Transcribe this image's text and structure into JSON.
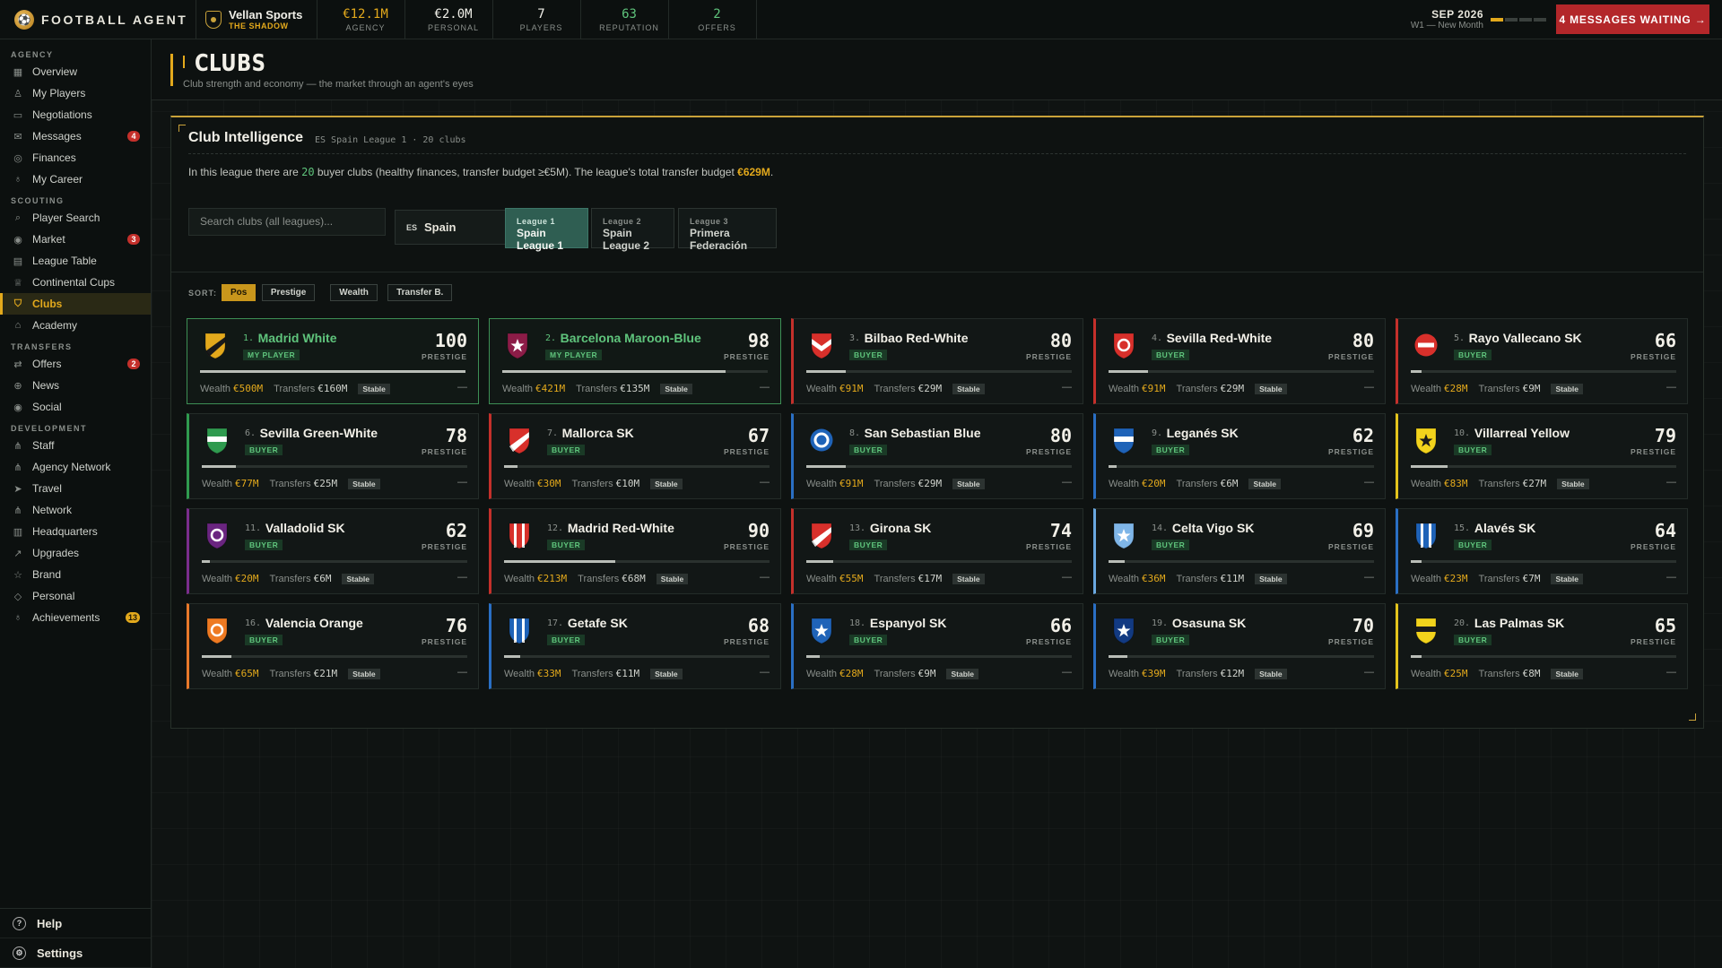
{
  "topbar": {
    "brand": "FOOTBALL AGENT",
    "agency_name": "Vellan Sports",
    "agency_tag": "THE SHADOW",
    "stats": [
      {
        "value": "€12.1M",
        "label": "AGENCY",
        "color": "gold"
      },
      {
        "value": "€2.0M",
        "label": "PERSONAL",
        "color": ""
      },
      {
        "value": "7",
        "label": "PLAYERS",
        "color": ""
      },
      {
        "value": "63",
        "label": "REPUTATION",
        "color": "green"
      },
      {
        "value": "2",
        "label": "OFFERS",
        "color": "green"
      }
    ],
    "date": "SEP 2026",
    "week": "W1 — New Month",
    "week_progress": 0.25,
    "messages_button": "4 MESSAGES WAITING →"
  },
  "sidebar": {
    "sections": [
      {
        "title": "AGENCY",
        "items": [
          {
            "label": "Overview",
            "icon": "grid-icon",
            "glyph": "▦"
          },
          {
            "label": "My Players",
            "icon": "user-icon",
            "glyph": "♙"
          },
          {
            "label": "Negotiations",
            "icon": "chat-icon",
            "glyph": "▭"
          },
          {
            "label": "Messages",
            "icon": "mail-icon",
            "glyph": "✉",
            "badge": "4"
          },
          {
            "label": "Finances",
            "icon": "coin-icon",
            "glyph": "◎"
          },
          {
            "label": "My Career",
            "icon": "medal-icon",
            "glyph": "♁"
          }
        ]
      },
      {
        "title": "SCOUTING",
        "items": [
          {
            "label": "Player Search",
            "icon": "search-icon",
            "glyph": "⌕"
          },
          {
            "label": "Market",
            "icon": "broadcast-icon",
            "glyph": "◉",
            "badge": "3"
          },
          {
            "label": "League Table",
            "icon": "table-icon",
            "glyph": "▤"
          },
          {
            "label": "Continental Cups",
            "icon": "trophy-icon",
            "glyph": "♕"
          },
          {
            "label": "Clubs",
            "icon": "shield-icon",
            "glyph": "⛉",
            "active": true
          },
          {
            "label": "Academy",
            "icon": "graduation-icon",
            "glyph": "⌂"
          }
        ]
      },
      {
        "title": "TRANSFERS",
        "items": [
          {
            "label": "Offers",
            "icon": "arrows-icon",
            "glyph": "⇄",
            "badge": "2"
          },
          {
            "label": "News",
            "icon": "globe-icon",
            "glyph": "⊕"
          },
          {
            "label": "Social",
            "icon": "broadcast-icon",
            "glyph": "◉"
          }
        ]
      },
      {
        "title": "DEVELOPMENT",
        "items": [
          {
            "label": "Staff",
            "icon": "network-icon",
            "glyph": "⋔"
          },
          {
            "label": "Agency Network",
            "icon": "network-icon",
            "glyph": "⋔"
          },
          {
            "label": "Travel",
            "icon": "plane-icon",
            "glyph": "➤"
          },
          {
            "label": "Network",
            "icon": "network-icon",
            "glyph": "⋔"
          },
          {
            "label": "Headquarters",
            "icon": "building-icon",
            "glyph": "▥"
          },
          {
            "label": "Upgrades",
            "icon": "trend-up-icon",
            "glyph": "↗"
          },
          {
            "label": "Brand",
            "icon": "star-icon",
            "glyph": "☆"
          },
          {
            "label": "Personal",
            "icon": "diamond-icon",
            "glyph": "◇"
          },
          {
            "label": "Achievements",
            "icon": "medal-icon",
            "glyph": "♁",
            "badge": "13",
            "badge_gold": true
          }
        ]
      }
    ],
    "footer": {
      "help": "Help",
      "settings": "Settings"
    }
  },
  "page": {
    "title": "CLUBS",
    "subtitle": "Club strength and economy — the market through an agent's eyes"
  },
  "intel": {
    "title": "Club Intelligence",
    "meta": "ES Spain League 1 · 20 clubs",
    "text_before": "In this league there are ",
    "buyer_count": "20",
    "text_middle": " buyer clubs (healthy finances, transfer budget ≥€5M). The league's total transfer budget ",
    "total_budget": "€629M",
    "text_after": ".",
    "search_placeholder": "Search clubs (all leagues)...",
    "country_code": "ES",
    "country": "Spain",
    "league_tabs": [
      {
        "key": "League 1",
        "name": "Spain League 1",
        "active": true
      },
      {
        "key": "League 2",
        "name": "Spain League 2",
        "active": false
      },
      {
        "key": "League 3",
        "name": "Primera Federación",
        "active": false
      }
    ],
    "sort_label": "SORT:",
    "sort_options": [
      {
        "label": "Pos",
        "active": true
      },
      {
        "label": "Prestige",
        "active": false
      },
      {
        "label": "Wealth",
        "active": false
      },
      {
        "label": "Transfer B.",
        "active": false
      }
    ],
    "wealth_label": "Wealth",
    "transfers_label": "Transfers",
    "prestige_label": "PRESTIGE"
  },
  "clubs": [
    {
      "pos": "1.",
      "name": "Madrid White",
      "role": "MY PLAYER",
      "mine": true,
      "prestige": "100",
      "wealth": "€500M",
      "transfers": "€160M",
      "status": "Stable",
      "trend": "—",
      "bar": 1.0,
      "accent": "#3d8f55",
      "c1": "#e3a91c",
      "c2": "#1a1a1a",
      "crest": "diag"
    },
    {
      "pos": "2.",
      "name": "Barcelona Maroon-Blue",
      "role": "MY PLAYER",
      "mine": true,
      "prestige": "98",
      "wealth": "€421M",
      "transfers": "€135M",
      "status": "Stable",
      "trend": "—",
      "bar": 0.84,
      "accent": "#3d8f55",
      "c1": "#8c1c47",
      "c2": "#ffffff",
      "crest": "star"
    },
    {
      "pos": "3.",
      "name": "Bilbao Red-White",
      "role": "BUYER",
      "mine": false,
      "prestige": "80",
      "wealth": "€91M",
      "transfers": "€29M",
      "status": "Stable",
      "trend": "—",
      "bar": 0.15,
      "accent": "#c4302b",
      "c1": "#d8302b",
      "c2": "#ffffff",
      "crest": "chevron"
    },
    {
      "pos": "4.",
      "name": "Sevilla Red-White",
      "role": "BUYER",
      "mine": false,
      "prestige": "80",
      "wealth": "€91M",
      "transfers": "€29M",
      "status": "Stable",
      "trend": "—",
      "bar": 0.15,
      "accent": "#c4302b",
      "c1": "#d8302b",
      "c2": "#ffffff",
      "crest": "ring"
    },
    {
      "pos": "5.",
      "name": "Rayo Vallecano SK",
      "role": "BUYER",
      "mine": false,
      "prestige": "66",
      "wealth": "€28M",
      "transfers": "€9M",
      "status": "Stable",
      "trend": "—",
      "bar": 0.04,
      "accent": "#c4302b",
      "c1": "#d8302b",
      "c2": "#ffffff",
      "crest": "bar"
    },
    {
      "pos": "6.",
      "name": "Sevilla Green-White",
      "role": "BUYER",
      "mine": false,
      "prestige": "78",
      "wealth": "€77M",
      "transfers": "€25M",
      "status": "Stable",
      "trend": "—",
      "bar": 0.13,
      "accent": "#2f9a4f",
      "c1": "#2f9a4f",
      "c2": "#ffffff",
      "crest": "band"
    },
    {
      "pos": "7.",
      "name": "Mallorca SK",
      "role": "BUYER",
      "mine": false,
      "prestige": "67",
      "wealth": "€30M",
      "transfers": "€10M",
      "status": "Stable",
      "trend": "—",
      "bar": 0.05,
      "accent": "#c4302b",
      "c1": "#d8302b",
      "c2": "#ffffff",
      "crest": "diag"
    },
    {
      "pos": "8.",
      "name": "San Sebastian Blue",
      "role": "BUYER",
      "mine": false,
      "prestige": "80",
      "wealth": "€91M",
      "transfers": "€29M",
      "status": "Stable",
      "trend": "—",
      "bar": 0.15,
      "accent": "#2a6fc4",
      "c1": "#1f63b8",
      "c2": "#ffffff",
      "crest": "circle"
    },
    {
      "pos": "9.",
      "name": "Leganés SK",
      "role": "BUYER",
      "mine": false,
      "prestige": "62",
      "wealth": "€20M",
      "transfers": "€6M",
      "status": "Stable",
      "trend": "—",
      "bar": 0.03,
      "accent": "#2a6fc4",
      "c1": "#1f63b8",
      "c2": "#ffffff",
      "crest": "band"
    },
    {
      "pos": "10.",
      "name": "Villarreal Yellow",
      "role": "BUYER",
      "mine": false,
      "prestige": "79",
      "wealth": "€83M",
      "transfers": "€27M",
      "status": "Stable",
      "trend": "—",
      "bar": 0.14,
      "accent": "#e3c41c",
      "c1": "#f2d31c",
      "c2": "#1a1a1a",
      "crest": "star"
    },
    {
      "pos": "11.",
      "name": "Valladolid SK",
      "role": "BUYER",
      "mine": false,
      "prestige": "62",
      "wealth": "€20M",
      "transfers": "€6M",
      "status": "Stable",
      "trend": "—",
      "bar": 0.03,
      "accent": "#7a2d8c",
      "c1": "#6a2580",
      "c2": "#ffffff",
      "crest": "ring"
    },
    {
      "pos": "12.",
      "name": "Madrid Red-White",
      "role": "BUYER",
      "mine": false,
      "prestige": "90",
      "wealth": "€213M",
      "transfers": "€68M",
      "status": "Stable",
      "trend": "—",
      "bar": 0.42,
      "accent": "#c4302b",
      "c1": "#d8302b",
      "c2": "#ffffff",
      "crest": "stripes"
    },
    {
      "pos": "13.",
      "name": "Girona SK",
      "role": "BUYER",
      "mine": false,
      "prestige": "74",
      "wealth": "€55M",
      "transfers": "€17M",
      "status": "Stable",
      "trend": "—",
      "bar": 0.1,
      "accent": "#c4302b",
      "c1": "#d8302b",
      "c2": "#ffffff",
      "crest": "diag"
    },
    {
      "pos": "14.",
      "name": "Celta Vigo SK",
      "role": "BUYER",
      "mine": false,
      "prestige": "69",
      "wealth": "€36M",
      "transfers": "€11M",
      "status": "Stable",
      "trend": "—",
      "bar": 0.06,
      "accent": "#6aa8e0",
      "c1": "#7fb6e8",
      "c2": "#ffffff",
      "crest": "star"
    },
    {
      "pos": "15.",
      "name": "Alavés SK",
      "role": "BUYER",
      "mine": false,
      "prestige": "64",
      "wealth": "€23M",
      "transfers": "€7M",
      "status": "Stable",
      "trend": "—",
      "bar": 0.04,
      "accent": "#2a6fc4",
      "c1": "#1f63b8",
      "c2": "#ffffff",
      "crest": "stripes"
    },
    {
      "pos": "16.",
      "name": "Valencia Orange",
      "role": "BUYER",
      "mine": false,
      "prestige": "76",
      "wealth": "€65M",
      "transfers": "€21M",
      "status": "Stable",
      "trend": "—",
      "bar": 0.11,
      "accent": "#e8782a",
      "c1": "#ee7a22",
      "c2": "#ffffff",
      "crest": "ring"
    },
    {
      "pos": "17.",
      "name": "Getafe SK",
      "role": "BUYER",
      "mine": false,
      "prestige": "68",
      "wealth": "€33M",
      "transfers": "€11M",
      "status": "Stable",
      "trend": "—",
      "bar": 0.06,
      "accent": "#2a6fc4",
      "c1": "#1f63b8",
      "c2": "#ffffff",
      "crest": "stripes"
    },
    {
      "pos": "18.",
      "name": "Espanyol SK",
      "role": "BUYER",
      "mine": false,
      "prestige": "66",
      "wealth": "€28M",
      "transfers": "€9M",
      "status": "Stable",
      "trend": "—",
      "bar": 0.05,
      "accent": "#2a6fc4",
      "c1": "#1f63b8",
      "c2": "#ffffff",
      "crest": "star"
    },
    {
      "pos": "19.",
      "name": "Osasuna SK",
      "role": "BUYER",
      "mine": false,
      "prestige": "70",
      "wealth": "€39M",
      "transfers": "€12M",
      "status": "Stable",
      "trend": "—",
      "bar": 0.07,
      "accent": "#2a6fc4",
      "c1": "#123a82",
      "c2": "#ffffff",
      "crest": "star"
    },
    {
      "pos": "20.",
      "name": "Las Palmas SK",
      "role": "BUYER",
      "mine": false,
      "prestige": "65",
      "wealth": "€25M",
      "transfers": "€8M",
      "status": "Stable",
      "trend": "—",
      "bar": 0.04,
      "accent": "#e3c41c",
      "c1": "#f2d31c",
      "c2": "#1a1a1a",
      "crest": "band"
    }
  ]
}
